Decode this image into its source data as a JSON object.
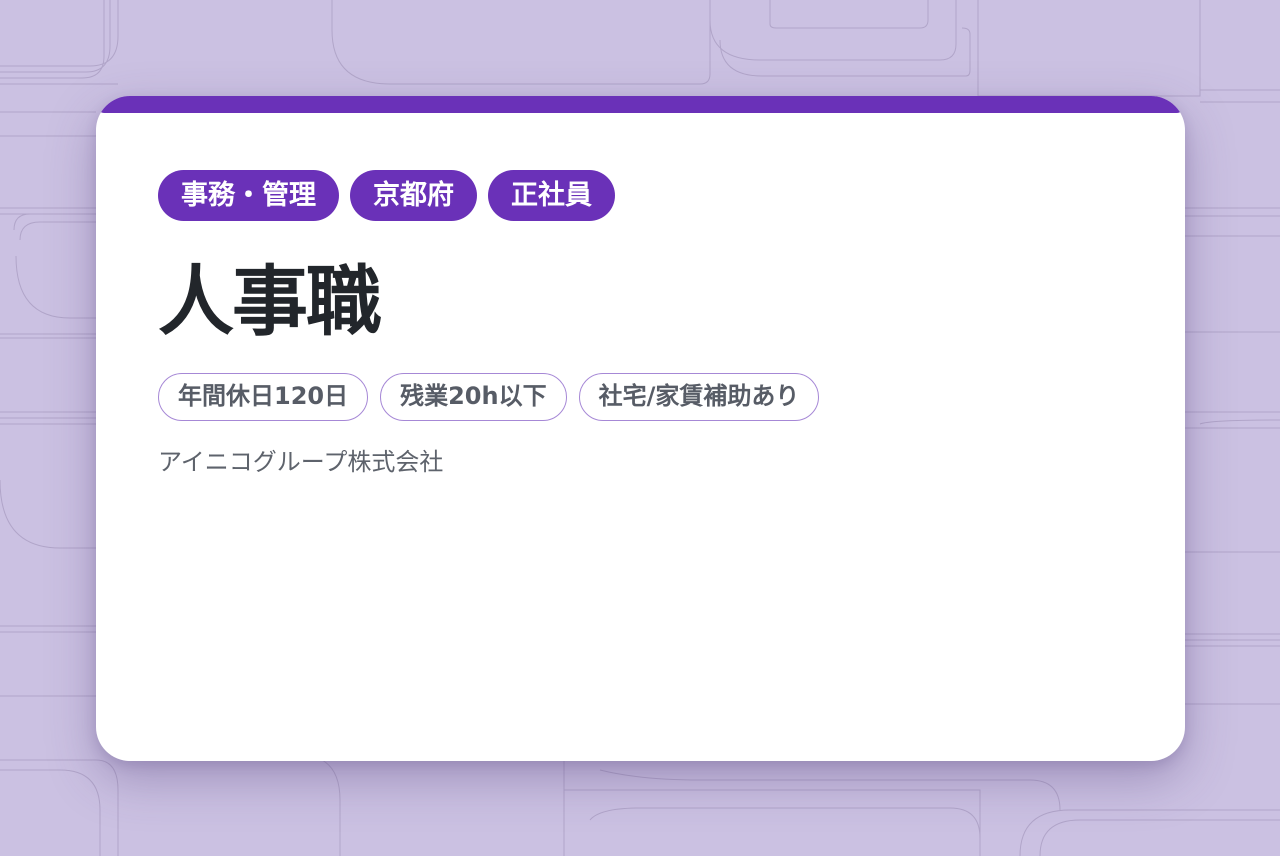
{
  "colors": {
    "background": "#cbc1e2",
    "accent": "#6a31b8",
    "title_text": "#22262b",
    "feature_border": "#a688d6",
    "muted_text": "#5e636c"
  },
  "job_card": {
    "category_tags": [
      "事務・管理",
      "京都府",
      "正社員"
    ],
    "title": "人事職",
    "feature_tags": [
      "年間休日120日",
      "残業20h以下",
      "社宅/家賃補助あり"
    ],
    "company": "アイニコグループ株式会社"
  }
}
